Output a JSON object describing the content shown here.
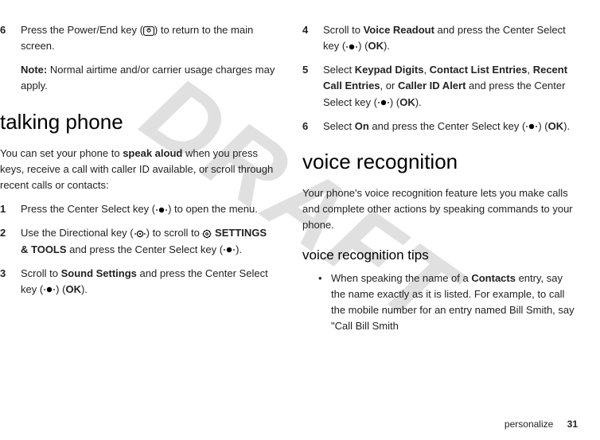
{
  "watermark": "DRAFT",
  "left": {
    "step6_num": "6",
    "step6_txt_a": "Press the Power/End key (",
    "step6_txt_b": ") to return to the main screen.",
    "note_label": "Note:",
    "note_txt": " Normal airtime and/or carrier usage charges may apply.",
    "section": "talking phone",
    "intro_a": "You can set your phone to ",
    "intro_bold": "speak aloud",
    "intro_b": " when you press keys, receive a call with caller ID available, or scroll through recent calls or contacts:",
    "s1_num": "1",
    "s1_a": "Press the Center Select key (",
    "s1_b": ") to open the menu.",
    "s2_num": "2",
    "s2_a": "Use the Directional key (",
    "s2_b": ") to scroll to ",
    "s2_tools": "SETTINGS & TOOLS",
    "s2_c": " and press the Center Select key (",
    "s2_d": ").",
    "s3_num": "3",
    "s3_a": "Scroll to ",
    "s3_item": "Sound Settings",
    "s3_b": " and press the Center Select key (",
    "s3_c": ") (",
    "s3_ok": "OK",
    "s3_d": ")."
  },
  "right": {
    "s4_num": "4",
    "s4_a": "Scroll to ",
    "s4_item": "Voice Readout",
    "s4_b": " and press the Center Select key (",
    "s4_c": ") (",
    "s4_ok": "OK",
    "s4_d": ").",
    "s5_num": "5",
    "s5_a": "Select ",
    "s5_item1": "Keypad Digits",
    "s5_sep1": ", ",
    "s5_item2": "Contact List Entries",
    "s5_sep2": ", ",
    "s5_item3": "Recent Call Entries",
    "s5_sep3": ", or ",
    "s5_item4": "Caller ID Alert",
    "s5_b": " and press the Center Select key (",
    "s5_c": ") (",
    "s5_ok": "OK",
    "s5_d": ").",
    "s6_num": "6",
    "s6_a": "Select ",
    "s6_item": "On",
    "s6_b": " and press the Center Select key (",
    "s6_c": ") (",
    "s6_ok": "OK",
    "s6_d": ").",
    "section": "voice recognition",
    "intro": "Your phone's voice recognition feature lets you make calls and complete other actions by speaking commands to your phone.",
    "sub": "voice recognition tips",
    "bullet": "•",
    "b1_a": "When speaking the name of a ",
    "b1_item": "Contacts",
    "b1_b": " entry, say the name exactly as it is listed. For example, to call the mobile number for an entry named Bill Smith, say \"Call Bill Smith"
  },
  "footer": {
    "label": "personalize",
    "page": "31"
  }
}
